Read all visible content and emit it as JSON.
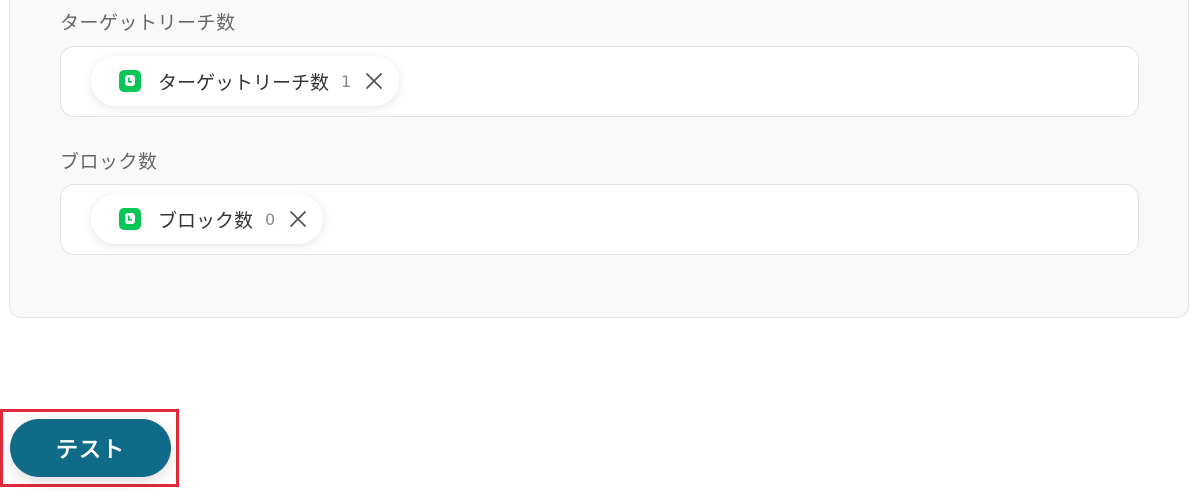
{
  "fields": [
    {
      "label": "ターゲットリーチ数",
      "chip": {
        "icon": "line-app-icon",
        "label": "ターゲットリーチ数",
        "index": "1"
      }
    },
    {
      "label": "ブロック数",
      "chip": {
        "icon": "line-app-icon",
        "label": "ブロック数",
        "index": "0"
      }
    }
  ],
  "actions": {
    "test_label": "テスト"
  },
  "colors": {
    "accent": "#0f6b88",
    "highlight": "#e02a3a",
    "line_green": "#06c755"
  }
}
